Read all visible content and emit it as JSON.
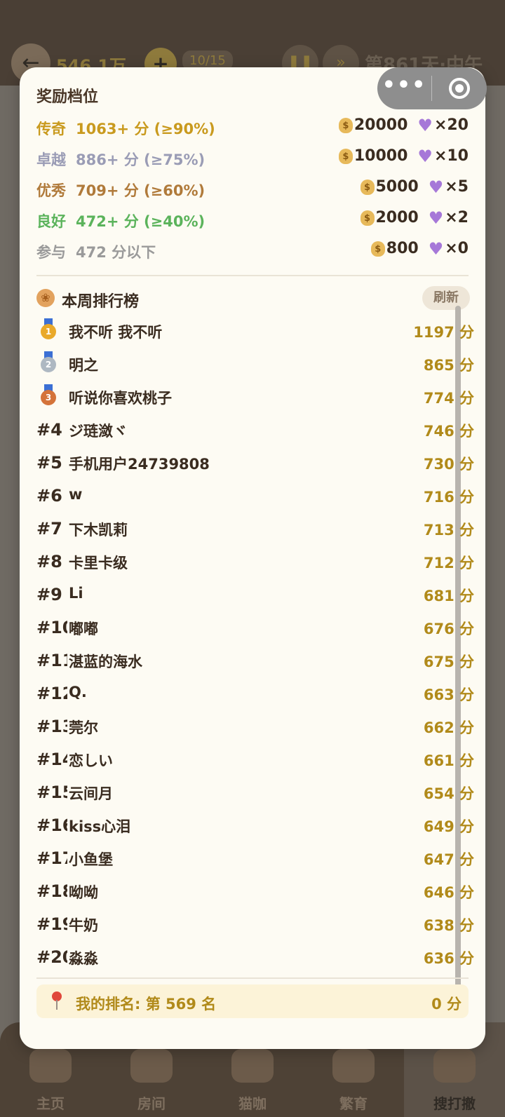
{
  "background": {
    "back_icon": "arrow-left-icon",
    "coin_amount": "546.1万",
    "plus_label": "+",
    "cat_count": "10/15",
    "day_label": "第861天·中午",
    "nav": [
      {
        "label": "主页",
        "icon": "home-icon"
      },
      {
        "label": "房间",
        "icon": "room-icon"
      },
      {
        "label": "猫咖",
        "icon": "cat-cafe-icon"
      },
      {
        "label": "繁育",
        "icon": "breeding-icon"
      },
      {
        "label": "搜打撤",
        "icon": "search-map-icon"
      }
    ]
  },
  "capsule": {
    "more_label": "•••"
  },
  "tiers": {
    "title": "奖励档位",
    "rows": [
      {
        "name": "传奇",
        "req": "1063+ 分 (≥90%)",
        "coins": "20000",
        "hearts": "×20",
        "color": "#c99a1e"
      },
      {
        "name": "卓越",
        "req": "886+ 分 (≥75%)",
        "coins": "10000",
        "hearts": "×10",
        "color": "#9a9cb5"
      },
      {
        "name": "优秀",
        "req": "709+ 分 (≥60%)",
        "coins": "5000",
        "hearts": "×5",
        "color": "#b07a3a"
      },
      {
        "name": "良好",
        "req": "472+ 分 (≥40%)",
        "coins": "2000",
        "hearts": "×2",
        "color": "#5bb35b"
      },
      {
        "name": "参与",
        "req": "472 分以下",
        "coins": "800",
        "hearts": "×0",
        "color": "#9a9a9a"
      }
    ]
  },
  "leaderboard": {
    "title": "本周排行榜",
    "refresh_label": "刷新",
    "rows": [
      {
        "rank": "1",
        "name": "我不听 我不听",
        "score": "1197 分"
      },
      {
        "rank": "2",
        "name": "明之",
        "score": "865 分"
      },
      {
        "rank": "3",
        "name": "听说你喜欢桃子",
        "score": "774 分"
      },
      {
        "rank": "#4",
        "name": "ジ琏潋ヾ",
        "score": "746 分"
      },
      {
        "rank": "#5",
        "name": "手机用户24739808",
        "score": "730 分"
      },
      {
        "rank": "#6",
        "name": "w",
        "score": "716 分"
      },
      {
        "rank": "#7",
        "name": "下木凯莉",
        "score": "713 分"
      },
      {
        "rank": "#8",
        "name": "卡里卡级",
        "score": "712 分"
      },
      {
        "rank": "#9",
        "name": "Li",
        "score": "681 分"
      },
      {
        "rank": "#10",
        "name": "嘟嘟",
        "score": "676 分"
      },
      {
        "rank": "#11",
        "name": "湛蓝的海水",
        "score": "675 分"
      },
      {
        "rank": "#12",
        "name": "Q.",
        "score": "663 分"
      },
      {
        "rank": "#13",
        "name": "莞尔",
        "score": "662 分"
      },
      {
        "rank": "#14",
        "name": "恋しい",
        "score": "661 分"
      },
      {
        "rank": "#15",
        "name": "云间月",
        "score": "654 分"
      },
      {
        "rank": "#16",
        "name": "kiss心泪",
        "score": "649 分"
      },
      {
        "rank": "#17",
        "name": "小鱼堡",
        "score": "647 分"
      },
      {
        "rank": "#18",
        "name": "呦呦",
        "score": "646 分"
      },
      {
        "rank": "#19",
        "name": "牛奶",
        "score": "638 分"
      },
      {
        "rank": "#20",
        "name": "淼淼",
        "score": "636 分"
      }
    ]
  },
  "my_rank": {
    "label": "我的排名: 第 569 名",
    "score": "0 分"
  }
}
